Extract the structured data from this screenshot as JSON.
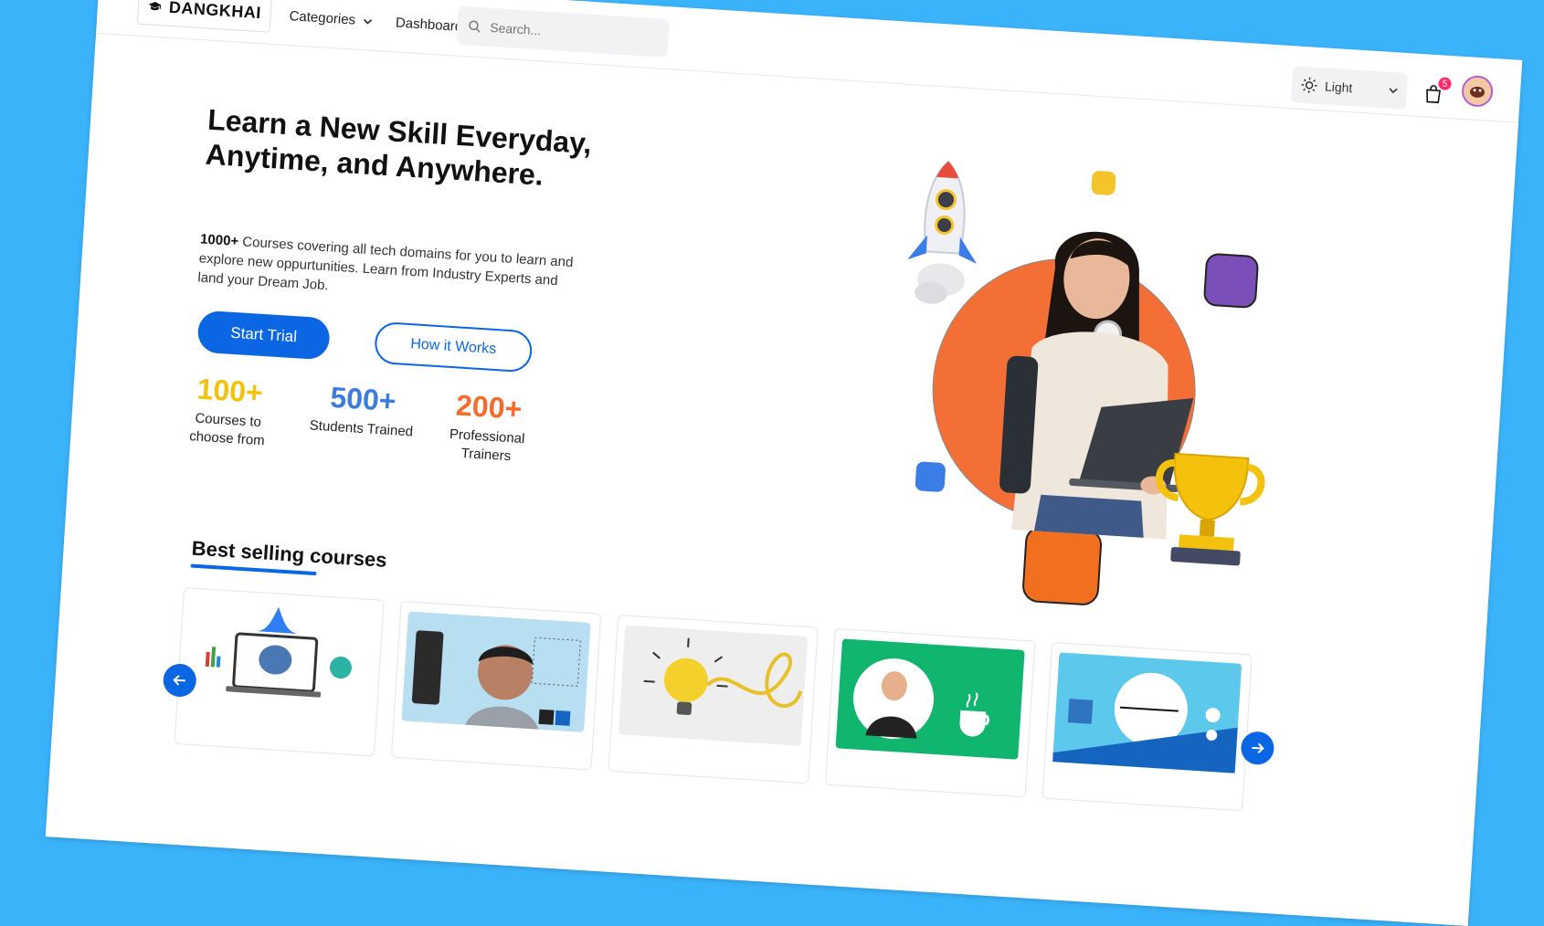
{
  "header": {
    "brand": "DANGKHAI",
    "nav": {
      "categories": "Categories",
      "dashboard": "Dashboard"
    },
    "search": {
      "placeholder": "Search..."
    },
    "theme": {
      "label": "Light"
    },
    "cart": {
      "count": "5"
    }
  },
  "hero": {
    "title": "Learn a New Skill Everyday, Anytime, and Anywhere.",
    "description_bold": "1000+",
    "description": " Courses covering all tech domains for you to learn and explore new oppurtunities. Learn from Industry Experts and land your Dream Job.",
    "primary_cta": "Start Trial",
    "secondary_cta": "How it Works",
    "stats": [
      {
        "value": "100+",
        "label": "Courses to choose from"
      },
      {
        "value": "500+",
        "label": "Students Trained"
      },
      {
        "value": "200+",
        "label": "Professional Trainers"
      }
    ]
  },
  "best_selling": {
    "title": "Best selling courses"
  },
  "colors": {
    "primary": "#0b66e4",
    "yellow": "#f4c20d",
    "blue": "#3a7dde",
    "orange": "#f46b2b"
  }
}
